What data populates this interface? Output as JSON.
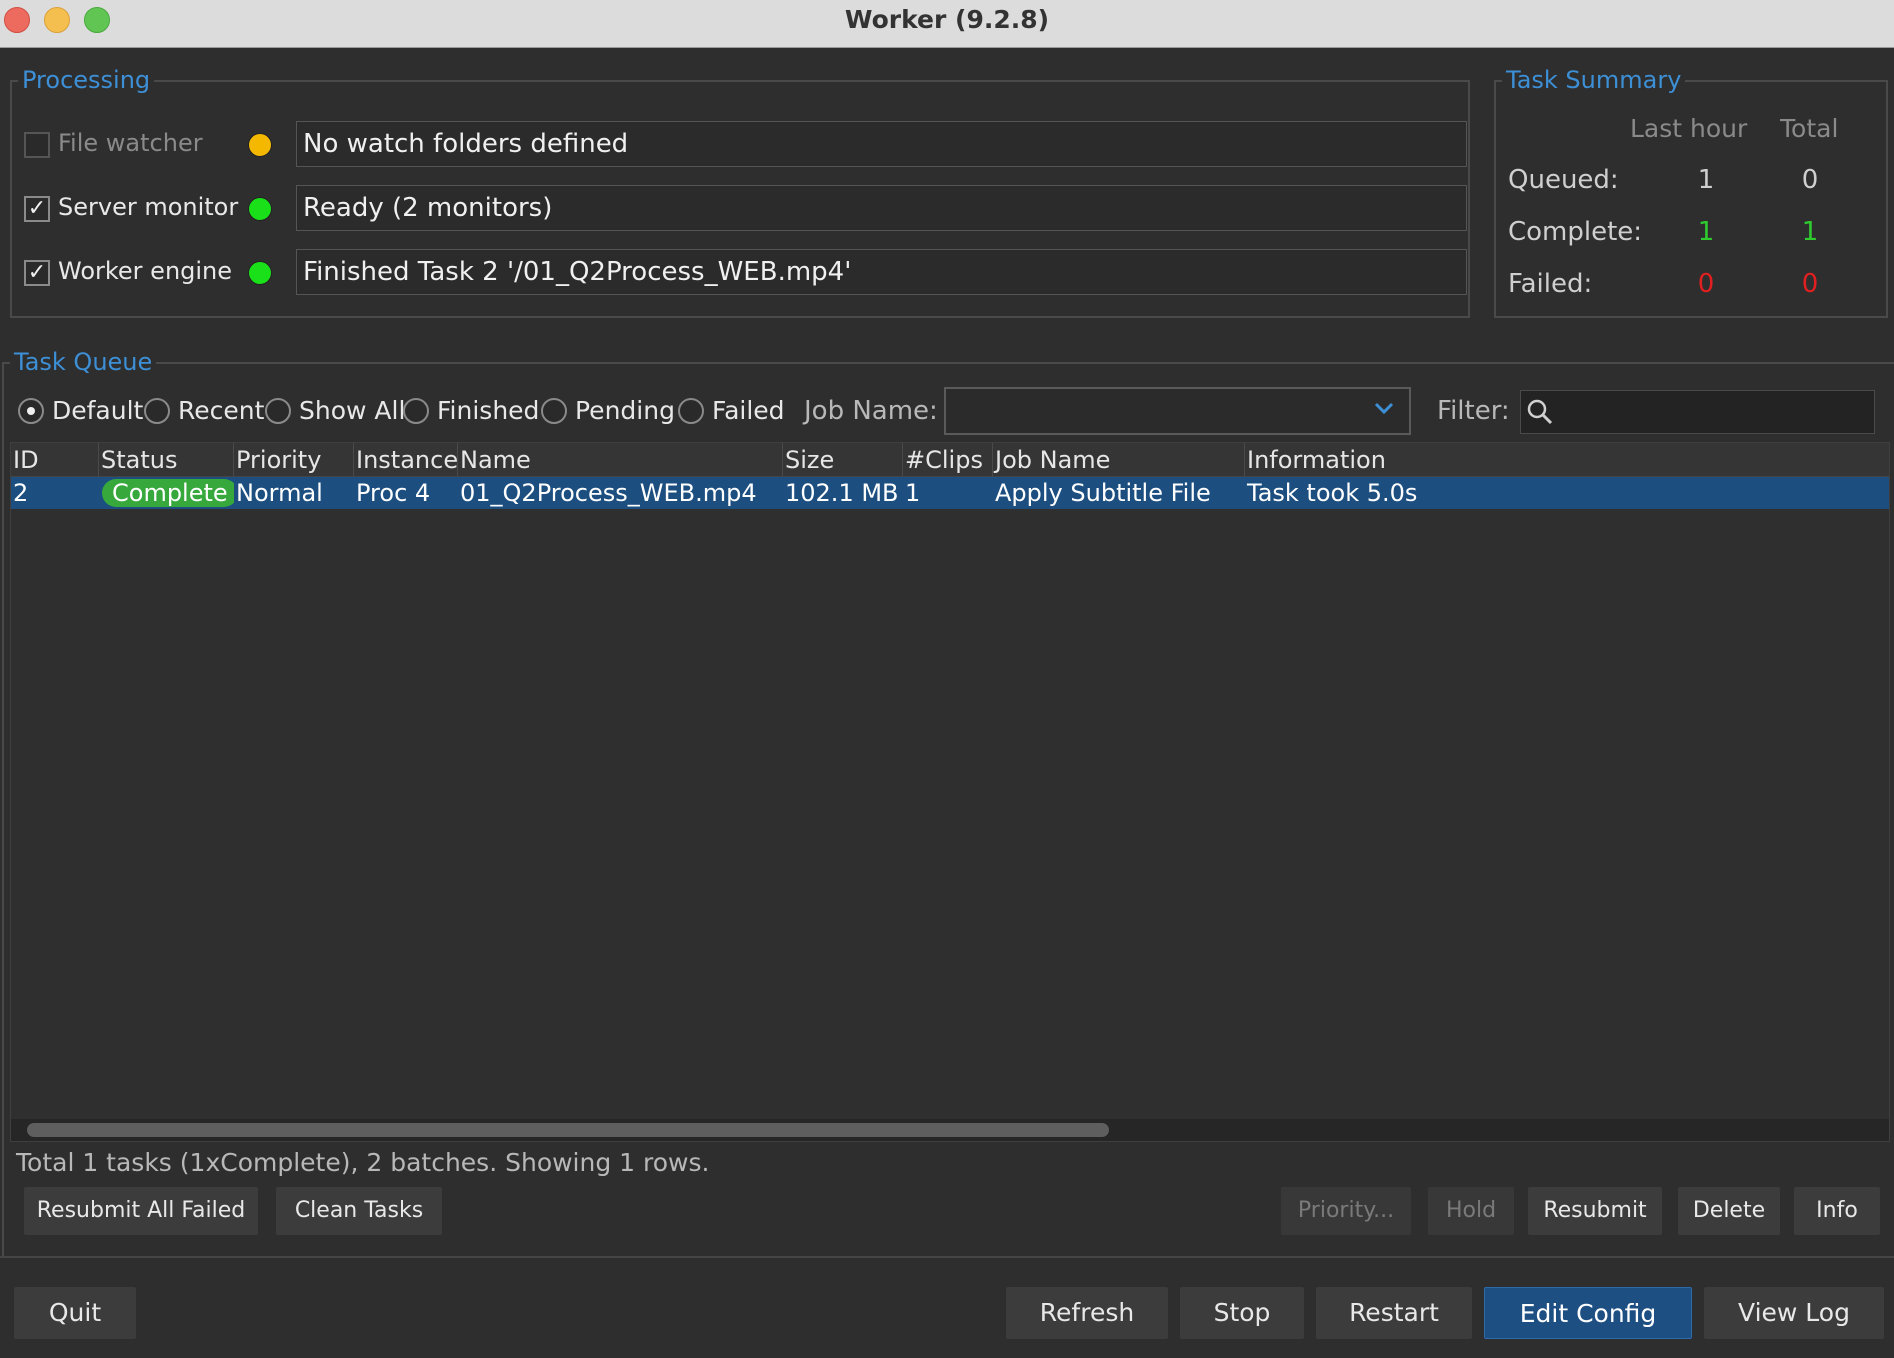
{
  "window": {
    "title": "Worker (9.2.8)"
  },
  "processing": {
    "legend": "Processing",
    "rows": [
      {
        "label": "File watcher",
        "checked": false,
        "enabled": false,
        "dot_color": "#f5b800",
        "status": "No watch folders defined"
      },
      {
        "label": "Server monitor",
        "checked": true,
        "enabled": true,
        "dot_color": "#19e019",
        "status": "Ready (2 monitors)"
      },
      {
        "label": "Worker engine",
        "checked": true,
        "enabled": true,
        "dot_color": "#19e019",
        "status": "Finished Task 2 '/01_Q2Process_WEB.mp4'"
      }
    ]
  },
  "summary": {
    "legend": "Task Summary",
    "col_last_hour": "Last hour",
    "col_total": "Total",
    "queued_label": "Queued:",
    "queued_hour": "1",
    "queued_total": "0",
    "complete_label": "Complete:",
    "complete_hour": "1",
    "complete_total": "1",
    "failed_label": "Failed:",
    "failed_hour": "0",
    "failed_total": "0"
  },
  "queue": {
    "legend": "Task Queue",
    "filters": [
      {
        "label": "Default",
        "checked": true
      },
      {
        "label": "Recent",
        "checked": false
      },
      {
        "label": "Show All",
        "checked": false
      },
      {
        "label": "Finished",
        "checked": false
      },
      {
        "label": "Pending",
        "checked": false
      },
      {
        "label": "Failed",
        "checked": false
      }
    ],
    "job_name_label": "Job Name:",
    "job_name_value": "",
    "filter_label": "Filter:",
    "filter_value": "",
    "columns": [
      "ID",
      "Status",
      "Priority",
      "Instance",
      "Name",
      "Size",
      "#Clips",
      "Job Name",
      "Information"
    ],
    "rows": [
      {
        "id": "2",
        "status": "Complete",
        "priority": "Normal",
        "instance": "Proc 4",
        "name": "01_Q2Process_WEB.mp4",
        "size": "102.1 MB",
        "clips": "1",
        "job_name": "Apply Subtitle File",
        "information": "Task took 5.0s"
      }
    ],
    "status_text": "Total 1 tasks (1xComplete), 2 batches. Showing 1 rows.",
    "buttons_left": [
      "Resubmit All Failed",
      "Clean Tasks"
    ],
    "buttons_right": [
      "Priority...",
      "Hold",
      "Resubmit",
      "Delete",
      "Info"
    ]
  },
  "bottom": {
    "quit": "Quit",
    "refresh": "Refresh",
    "stop": "Stop",
    "restart": "Restart",
    "edit_config": "Edit Config",
    "view_log": "View Log"
  },
  "colors": {
    "accent": "#3d8fd6",
    "selection": "#1c4f80",
    "complete_badge": "#36a83c",
    "green_value": "#2ecc2e",
    "red_value": "#e02020"
  }
}
